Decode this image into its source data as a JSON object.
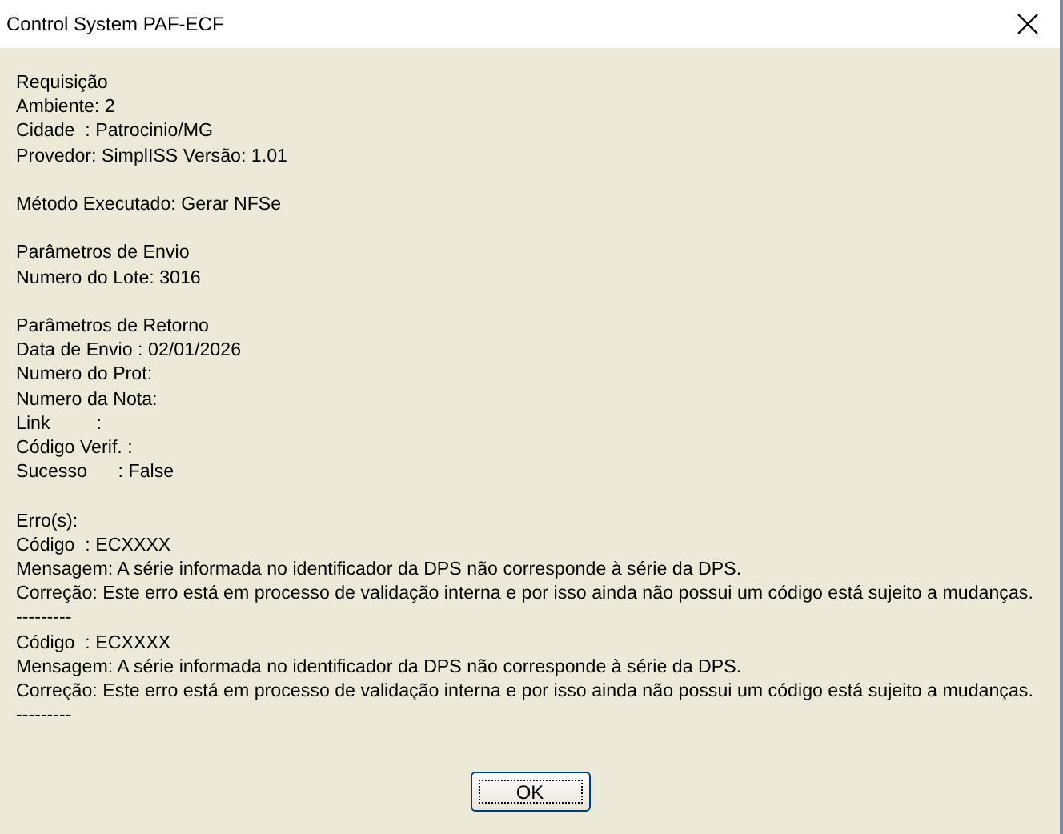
{
  "window": {
    "title": "Control System PAF-ECF"
  },
  "message_sections": [
    [
      "Requisição",
      "Ambiente: 2",
      "Cidade  : Patrocinio/MG",
      "Provedor: SimplISS Versão: 1.01"
    ],
    [
      "Método Executado: Gerar NFSe"
    ],
    [
      "Parâmetros de Envio",
      "Numero do Lote: 3016"
    ],
    [
      "Parâmetros de Retorno",
      "Data de Envio : 02/01/2026",
      "Numero do Prot:",
      "Numero da Nota:",
      "Link         :",
      "Código Verif. :",
      "Sucesso      : False"
    ],
    [
      "Erro(s):",
      "Código  : ECXXXX",
      "Mensagem: A série informada no identificador da DPS não corresponde à série da DPS.",
      "Correção: Este erro está em processo de validação interna e por isso ainda não possui um código está sujeito a mudanças.",
      "---------",
      "Código  : ECXXXX",
      "Mensagem: A série informada no identificador da DPS não corresponde à série da DPS.",
      "Correção: Este erro está em processo de validação interna e por isso ainda não possui um código está sujeito a mudanças.",
      "---------"
    ]
  ],
  "buttons": [
    {
      "label": "OK",
      "focused": true
    }
  ]
}
